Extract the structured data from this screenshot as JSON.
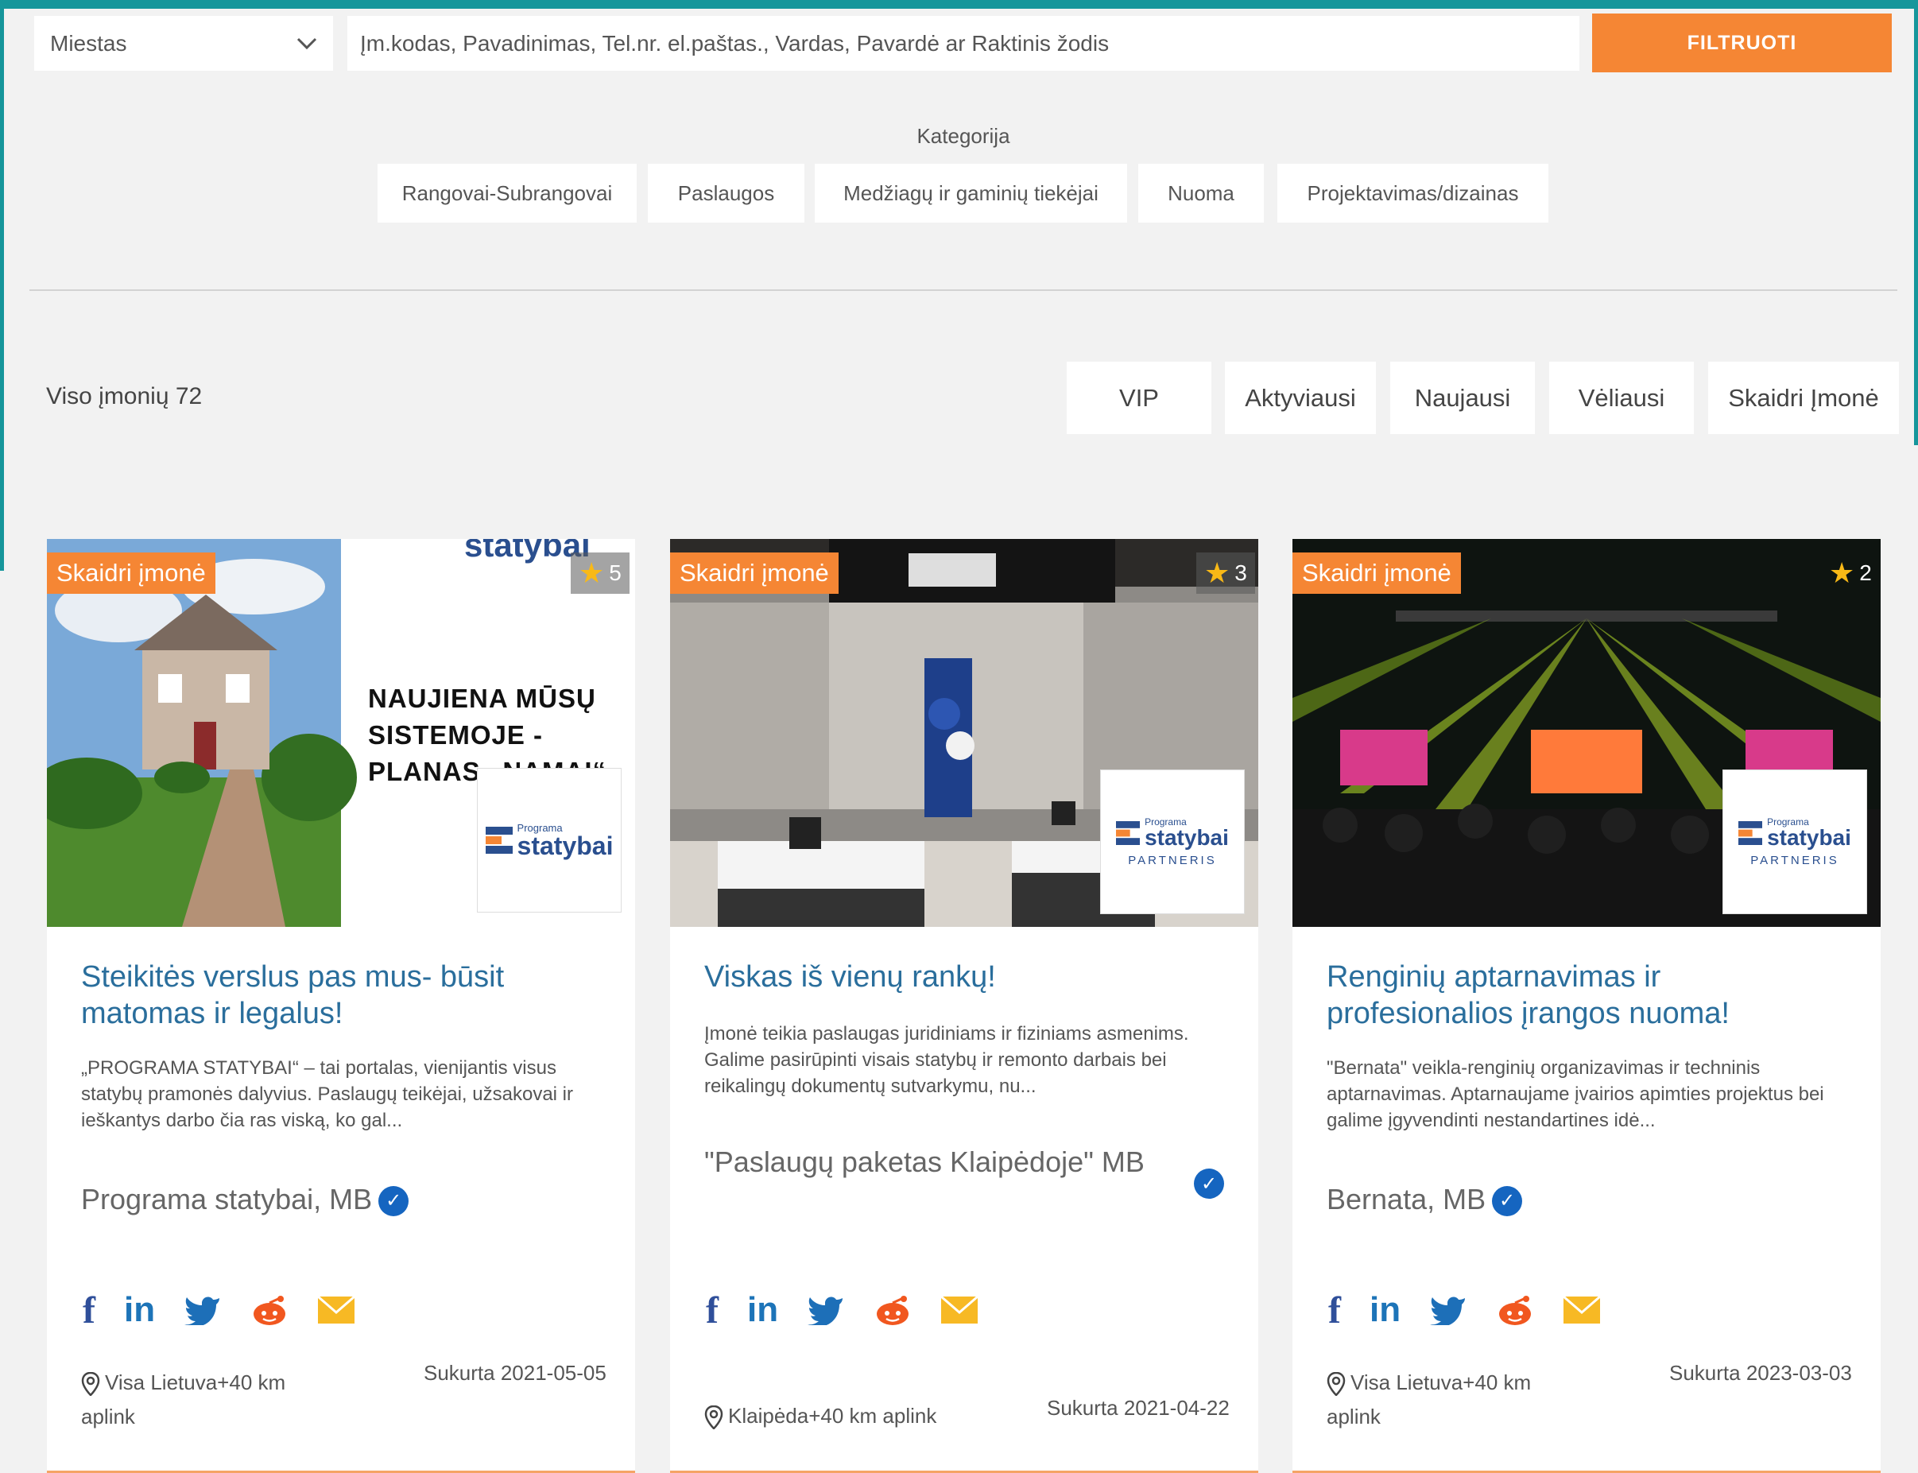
{
  "filters": {
    "city_label": "Miestas",
    "search_placeholder": "Įm.kodas, Pavadinimas, Tel.nr. el.paštas., Vardas, Pavardė ar Raktinis žodis",
    "filter_button": "FILTRUOTI"
  },
  "category": {
    "title": "Kategorija",
    "items": [
      "Rangovai-Subrangovai",
      "Paslaugos",
      "Medžiagų ir gaminių tiekėjai",
      "Nuoma",
      "Projektavimas/dizainas"
    ]
  },
  "results": {
    "total_text": "Viso įmonių 72",
    "sort_options": [
      "VIP",
      "Aktyviausi",
      "Naujausi",
      "Vėliausi",
      "Skaidri Įmonė"
    ]
  },
  "colors": {
    "accent_orange": "#f58634",
    "teal": "#16969b",
    "title_blue": "#2a6e9c",
    "verified_blue": "#1565c0"
  },
  "cards": [
    {
      "badge": "Skaidri įmonė",
      "rating": "5",
      "image_text_top": "statybai",
      "image_headline": [
        "NAUJIENA MŪSŲ",
        "SISTEMOJE -",
        "PLANAS „NAMAI“"
      ],
      "logo_small": "Programa",
      "logo_main": "statybai",
      "logo_sub": "",
      "title": "Steikitės verslus pas mus- būsit matomas ir legalus!",
      "description": "„PROGRAMA STATYBAI“ – tai portalas, vienijantis visus statybų pramonės dalyvius. Paslaugų teikėjai, užsakovai ir ieškantys darbo čia ras viską, ko gal...",
      "company": "Programa statybai, MB",
      "location": "Visa Lietuva+40 km aplink",
      "created": "Sukurta 2021-05-05"
    },
    {
      "badge": "Skaidri įmonė",
      "rating": "3",
      "logo_small": "Programa",
      "logo_main": "statybai",
      "logo_sub": "PARTNERIS",
      "title": "Viskas iš vienų rankų!",
      "description": "Įmonė teikia paslaugas juridiniams ir fiziniams asmenims. Galime pasirūpinti visais statybų ir remonto darbais bei reikalingų dokumentų sutvarkymu, nu...",
      "company": "\"Paslaugų paketas Klaipėdoje\" MB",
      "location": "Klaipėda+40 km aplink",
      "created": "Sukurta 2021-04-22"
    },
    {
      "badge": "Skaidri įmonė",
      "rating": "2",
      "logo_small": "Programa",
      "logo_main": "statybai",
      "logo_sub": "PARTNERIS",
      "title": "Renginių aptarnavimas ir profesionalios įrangos nuoma!",
      "description": "\"Bernata\" veikla-renginių organizavimas ir techninis aptarnavimas. Aptarnaujame įvairios apimties projektus bei galime įgyvendinti nestandartines idė...",
      "company": "Bernata, MB",
      "location": "Visa Lietuva+40 km aplink",
      "created": "Sukurta 2023-03-03"
    }
  ]
}
